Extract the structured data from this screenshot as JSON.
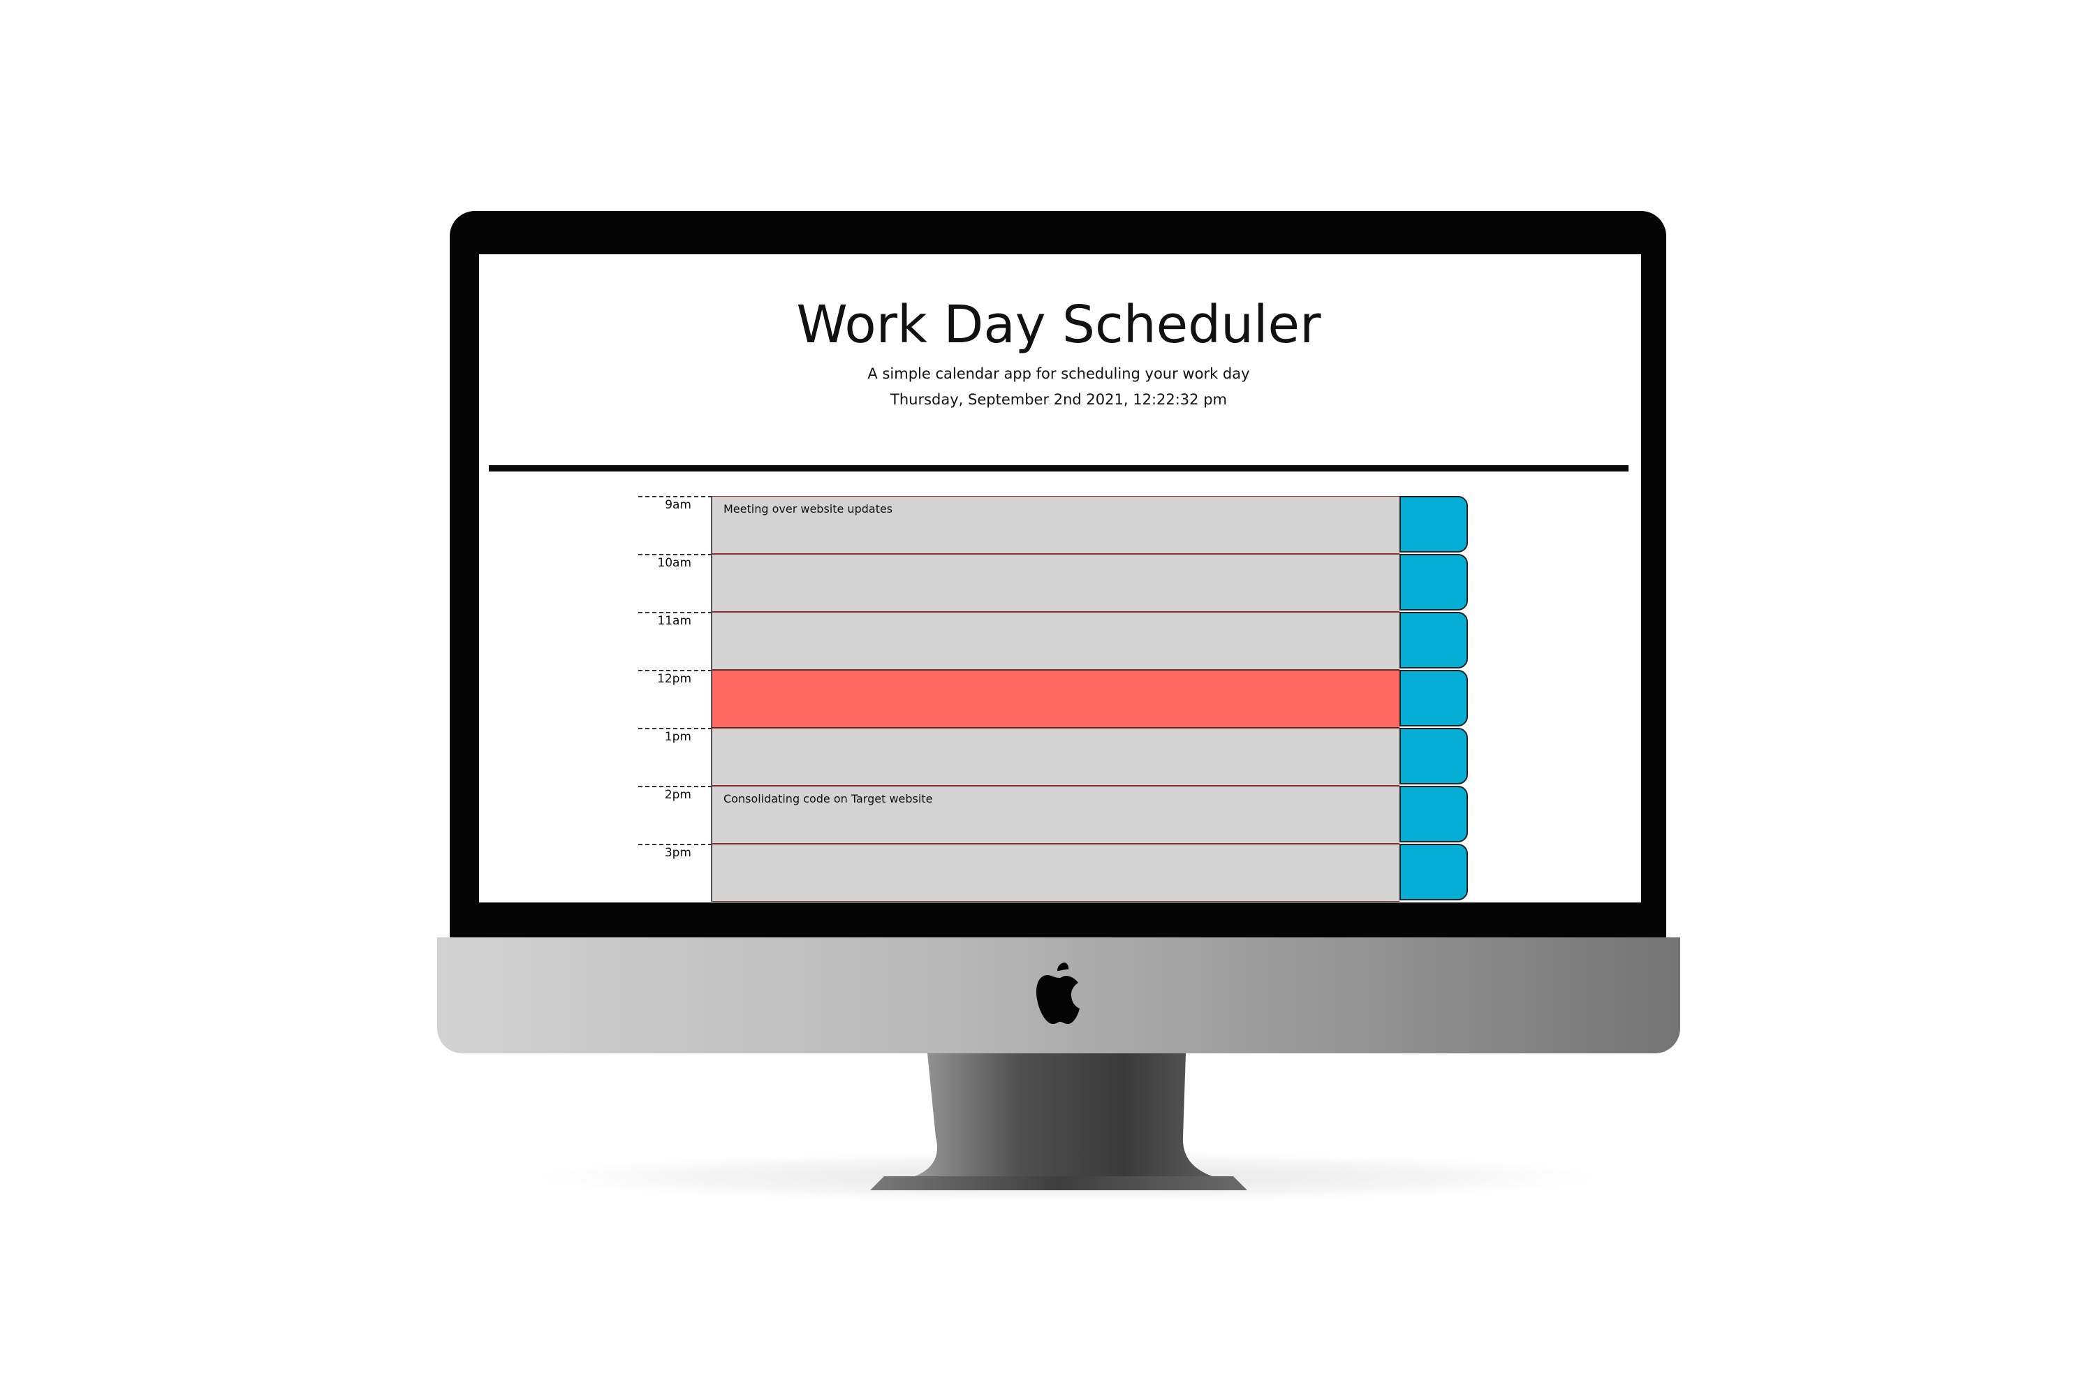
{
  "header": {
    "title": "Work Day Scheduler",
    "lead": "A simple calendar app for scheduling your work day",
    "current_day": "Thursday, September 2nd 2021, 12:22:32 pm"
  },
  "time_blocks": [
    {
      "hour": "9am",
      "text": "Meeting over website updates",
      "status": "past"
    },
    {
      "hour": "10am",
      "text": "",
      "status": "past"
    },
    {
      "hour": "11am",
      "text": "",
      "status": "past"
    },
    {
      "hour": "12pm",
      "text": "",
      "status": "present"
    },
    {
      "hour": "1pm",
      "text": "",
      "status": "past"
    },
    {
      "hour": "2pm",
      "text": "Consolidating code on Target website",
      "status": "past"
    },
    {
      "hour": "3pm",
      "text": "",
      "status": "past"
    }
  ],
  "colors": {
    "past": "#d3d3d3",
    "present": "#ff6961",
    "save_button": "#06aed5"
  },
  "device": {
    "logo_icon": "apple-logo-icon"
  }
}
